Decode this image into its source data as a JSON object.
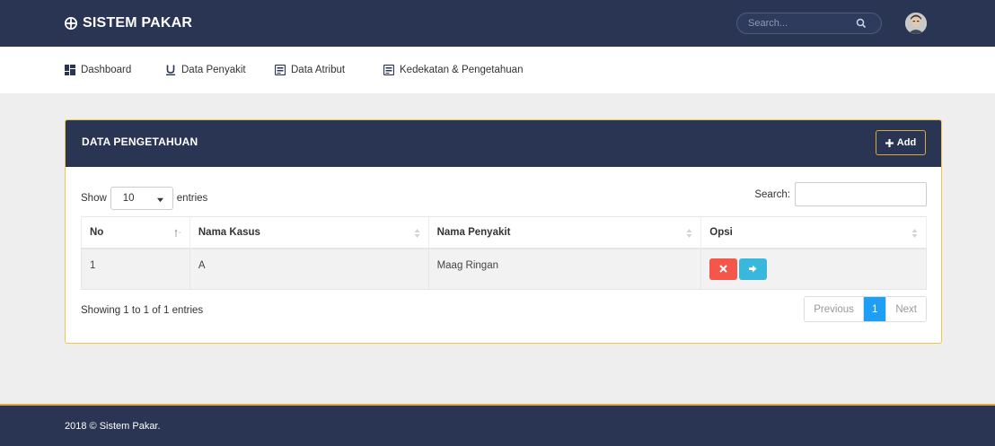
{
  "app": {
    "title": "SISTEM PAKAR",
    "search_placeholder": "Search..."
  },
  "nav": [
    {
      "label": "Dashboard",
      "icon": "dashboard-icon"
    },
    {
      "label": "Data Penyakit",
      "icon": "underline-icon"
    },
    {
      "label": "Data Atribut",
      "icon": "list-icon"
    },
    {
      "label": "Kedekatan & Pengetahuan",
      "icon": "list-icon"
    }
  ],
  "panel": {
    "title": "DATA PENGETAHUAN",
    "add_label": "Add",
    "show_label": "Show",
    "entries_value": "10",
    "entries_label": "entries",
    "search_label": "Search:"
  },
  "table": {
    "columns": [
      "No",
      "Nama Kasus",
      "Nama Penyakit",
      "Opsi"
    ],
    "rows": [
      {
        "no": "1",
        "nama_kasus": "A",
        "nama_penyakit": "Maag Ringan"
      }
    ]
  },
  "pager": {
    "info": "Showing 1 to 1 of 1 entries",
    "previous": "Previous",
    "current": "1",
    "next": "Next"
  },
  "footer": {
    "text": "2018 © Sistem Pakar."
  },
  "colors": {
    "header_bg": "#2a3553",
    "accent_border": "#f0c64a",
    "delete_button": "#f4564a",
    "login_button": "#3ab7dc",
    "active_page": "#1e9ef4"
  }
}
